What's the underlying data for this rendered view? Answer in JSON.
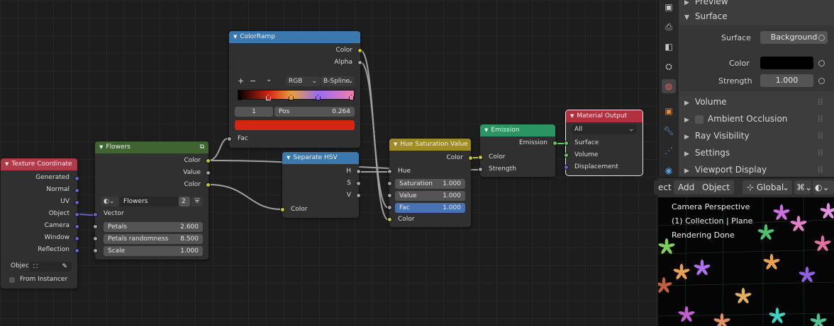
{
  "nodes": {
    "texcoord": {
      "title": "Texture Coordinate",
      "outputs": [
        "Generated",
        "Normal",
        "UV",
        "Object",
        "Camera",
        "Window",
        "Reflection"
      ],
      "object_label": "Objec",
      "from_instancer": "From Instancer"
    },
    "flowers": {
      "title": "Flowers",
      "outputs": [
        "Color",
        "Value",
        "Color"
      ],
      "texture_name": "Flowers",
      "users": "2",
      "vector_label": "Vector",
      "inputs": [
        {
          "label": "Petals",
          "value": "2.600"
        },
        {
          "label": "Petals randomness",
          "value": "8.500"
        },
        {
          "label": "Scale",
          "value": "1.000"
        }
      ]
    },
    "colorramp": {
      "title": "ColorRamp",
      "outputs": [
        "Color",
        "Alpha"
      ],
      "add": "+",
      "remove": "−",
      "menu": "⌄",
      "color_mode": "RGB",
      "interpolation": "B-Spline",
      "stop_index": "1",
      "pos_label": "Pos",
      "pos_value": "0.264",
      "fac_label": "Fac",
      "active_color": "#d42513",
      "gradient_stops": [
        {
          "pos": 0.0,
          "color": "#000000"
        },
        {
          "pos": 0.264,
          "color": "#d42513"
        },
        {
          "pos": 0.46,
          "color": "#e8a03c"
        },
        {
          "pos": 0.69,
          "color": "#9a6cf0"
        },
        {
          "pos": 1.0,
          "color": "#f07fb0"
        }
      ]
    },
    "separate": {
      "title": "Separate HSV",
      "outputs": [
        "H",
        "S",
        "V"
      ],
      "input": "Color"
    },
    "huesat": {
      "title": "Hue Saturation Value",
      "output": "Color",
      "hue": "Hue",
      "saturation": {
        "label": "Saturation",
        "value": "1.000"
      },
      "value": {
        "label": "Value",
        "value": "1.000"
      },
      "fac": {
        "label": "Fac",
        "value": "1.000"
      },
      "color": "Color"
    },
    "emission": {
      "title": "Emission",
      "output": "Emission",
      "inputs": [
        "Color",
        "Strength"
      ]
    },
    "output": {
      "title": "Material Output",
      "target": "All",
      "inputs": [
        "Surface",
        "Volume",
        "Displacement"
      ]
    }
  },
  "properties": {
    "preview": "Preview",
    "surface_panel": "Surface",
    "surface_label": "Surface",
    "surface_value": "Background",
    "color_label": "Color",
    "strength_label": "Strength",
    "strength_value": "1.000",
    "panels": [
      "Volume",
      "Ambient Occlusion",
      "Ray Visibility",
      "Settings",
      "Viewport Display"
    ]
  },
  "viewport_header": {
    "select": "ect",
    "add": "Add",
    "object": "Object",
    "orientation": "Global"
  },
  "viewport_overlay": [
    "Camera Perspective",
    "(1) Collection | Plane",
    "Rendering Done"
  ],
  "colors": {
    "header_input": "#b03a47",
    "header_texture": "#3f6432",
    "header_converter": "#3b78ad",
    "header_color": "#a08b29",
    "header_shader": "#2b9463",
    "header_output": "#b33040"
  }
}
